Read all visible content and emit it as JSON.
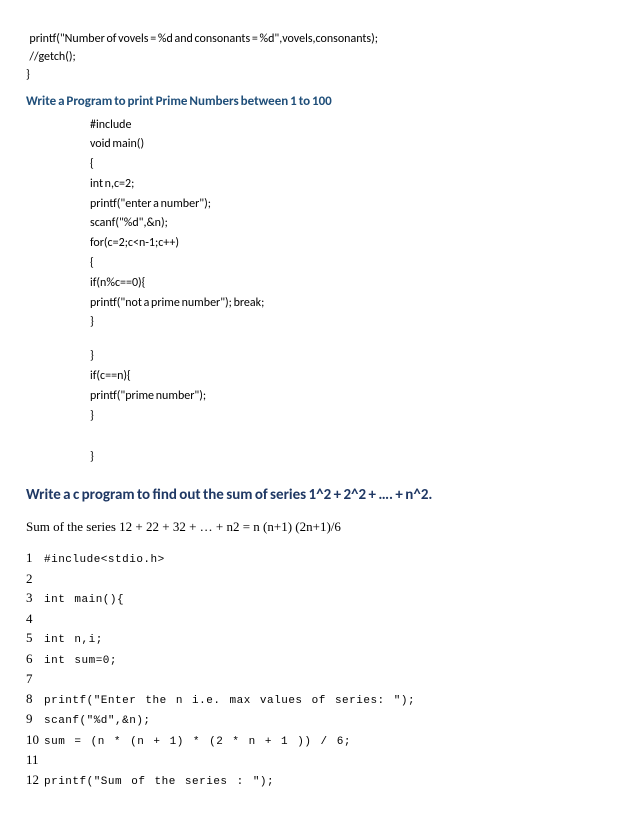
{
  "top_code": {
    "line1": "  printf(\"Number of vovels = %d and consonants = %d\",vovels,consonants);",
    "line2": "  //getch();",
    "line3": "}"
  },
  "heading1": "Write a Program to print Prime Numbers between 1 to 100",
  "prime_code": {
    "l1": "#include",
    "l2": "void main()",
    "l3": "{",
    "l4": "int n,c=2;",
    "l5": "printf(\"enter a number\");",
    "l6": "scanf(\"%d\",&n);",
    "l7": "for(c=2;c<n-1;c++)",
    "l8": "{",
    "l9": "if(n%c==0){",
    "l10": "printf(\"not a prime number\"); break;",
    "l11": "}",
    "l12": "}",
    "l13": "if(c==n){",
    "l14": "printf(\"prime number\");",
    "l15": "}",
    "l16": "}"
  },
  "heading2": "Write a c program to find out the sum of series 1^2 + 2^2 + …. + n^2.",
  "formula": "Sum of the series  12 + 22 + 32 + … + n2 = n (n+1) (2n+1)/6",
  "numbered": {
    "n1": "1",
    "c1": "#include<stdio.h>",
    "n2": "2",
    "c2": "",
    "n3": "3",
    "c3": "int main(){",
    "n4": "4",
    "c4": "",
    "n5": "5",
    "c5": "int n,i;",
    "n6": "6",
    "c6": "int sum=0;",
    "n7": "7",
    "c7": "",
    "n8": "8",
    "c8": "printf(\"Enter the n i.e. max values of series: \");",
    "n9": "9",
    "c9": "scanf(\"%d\",&n);",
    "n10": "10",
    "c10": "sum = (n * (n + 1) * (2 * n + 1 )) / 6;",
    "n11": "11",
    "c11": "",
    "n12": "12",
    "c12": "printf(\"Sum of the series : \");"
  }
}
